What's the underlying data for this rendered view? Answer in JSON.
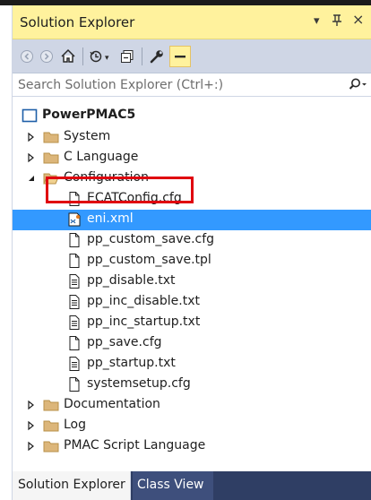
{
  "window": {
    "title": "Solution Explorer",
    "controls": {
      "dropdown": "▾",
      "pin": "⊥",
      "close": "×"
    }
  },
  "toolbar": {
    "buttons": [
      "back-icon",
      "forward-icon",
      "home-icon",
      "history-icon",
      "collapse-icon",
      "properties-icon",
      "preview-icon"
    ]
  },
  "search": {
    "placeholder": "Search Solution Explorer (Ctrl+:)",
    "value": ""
  },
  "tree": {
    "root": "PowerPMAC5",
    "items": [
      {
        "label": "System",
        "type": "folder",
        "expanded": false
      },
      {
        "label": "C Language",
        "type": "folder",
        "expanded": false
      },
      {
        "label": "Configuration",
        "type": "folder",
        "expanded": true
      },
      {
        "label": "ECATConfig.cfg",
        "type": "file"
      },
      {
        "label": "eni.xml",
        "type": "xml",
        "selected": true
      },
      {
        "label": "pp_custom_save.cfg",
        "type": "file"
      },
      {
        "label": "pp_custom_save.tpl",
        "type": "file"
      },
      {
        "label": "pp_disable.txt",
        "type": "text"
      },
      {
        "label": "pp_inc_disable.txt",
        "type": "text"
      },
      {
        "label": "pp_inc_startup.txt",
        "type": "text"
      },
      {
        "label": "pp_save.cfg",
        "type": "file"
      },
      {
        "label": "pp_startup.txt",
        "type": "text"
      },
      {
        "label": "systemsetup.cfg",
        "type": "file"
      },
      {
        "label": "Documentation",
        "type": "folder",
        "expanded": false
      },
      {
        "label": "Log",
        "type": "folder",
        "expanded": false
      },
      {
        "label": "PMAC Script Language",
        "type": "folder",
        "expanded": false
      }
    ]
  },
  "tabs": {
    "active": "Solution Explorer",
    "inactive": "Class View"
  },
  "colors": {
    "title_bar": "#fff29d",
    "toolbar": "#cfd6e5",
    "selection": "#3399ff",
    "highlight_box": "#e0000f",
    "tab_strip": "#2f3e64"
  }
}
